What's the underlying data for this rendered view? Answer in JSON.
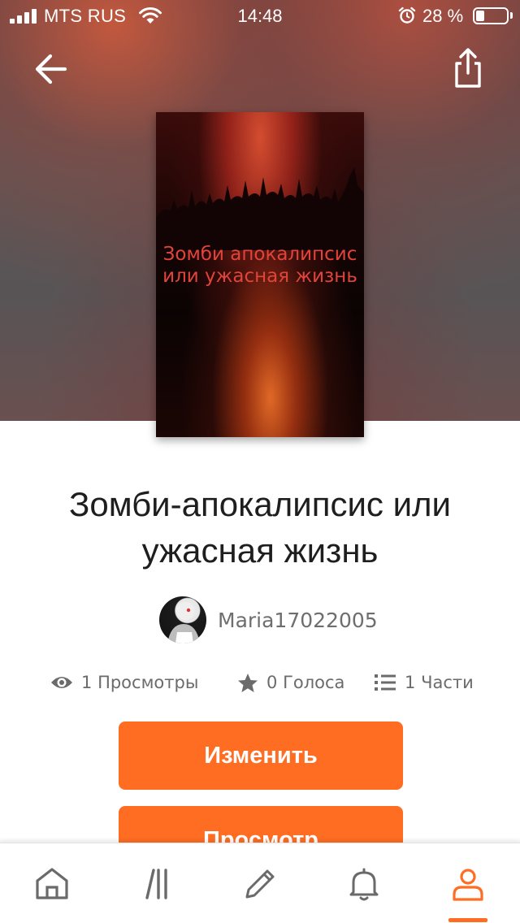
{
  "status_bar": {
    "carrier": "MTS RUS",
    "time": "14:48",
    "battery_percent": "28 %",
    "battery_level": 0.28
  },
  "nav": {
    "back_icon": "arrow-left-icon",
    "share_icon": "share-icon"
  },
  "cover": {
    "title": "Зомби апокалипсис или ужасная жизнь"
  },
  "story": {
    "title": "Зомби-апокалипсис или ужасная жизнь",
    "author": "Maria17022005"
  },
  "stats": {
    "views": {
      "value": "1",
      "label": "Просмотры",
      "icon": "eye-icon"
    },
    "votes": {
      "value": "0",
      "label": "Голоса",
      "icon": "star-icon"
    },
    "parts": {
      "value": "1",
      "label": "Части",
      "icon": "list-icon"
    }
  },
  "buttons": {
    "edit": "Изменить",
    "view": "Просмотр"
  },
  "tab_bar": {
    "items": [
      {
        "icon": "home-icon",
        "active": false
      },
      {
        "icon": "library-icon",
        "active": false
      },
      {
        "icon": "pencil-icon",
        "active": false
      },
      {
        "icon": "bell-icon",
        "active": false
      },
      {
        "icon": "profile-icon",
        "active": true
      }
    ],
    "accent": "#ff6d22"
  }
}
